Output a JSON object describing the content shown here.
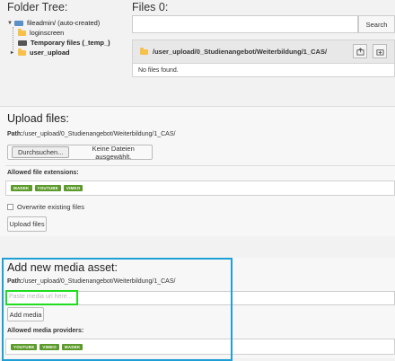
{
  "folder_tree": {
    "title": "Folder Tree:",
    "root": "fileadmin/ (auto-created)",
    "items": [
      "loginscreen",
      "Temporary files (_temp_)",
      "user_upload"
    ]
  },
  "files": {
    "title": "Files 0:",
    "search_placeholder": "",
    "search_button": "Search",
    "path": "/user_upload/0_Studienangebot/Weiterbildung/1_CAS/",
    "empty_message": "No files found."
  },
  "upload": {
    "title": "Upload files:",
    "path_label": "Path:",
    "path": "/user_upload/0_Studienangebot/Weiterbildung/1_CAS/",
    "browse_button": "Durchsuchen...",
    "no_files_text": "Keine Dateien ausgewählt.",
    "extensions_label": "Allowed file extensions:",
    "extensions": [
      "MADEK",
      "YOUTUBE",
      "VIMEO"
    ],
    "overwrite_label": "Overwrite existing files",
    "overwrite_checked": false,
    "submit_button": "Upload files"
  },
  "media": {
    "title": "Add new media asset:",
    "path_label": "Path:",
    "path": "/user_upload/0_Studienangebot/Weiterbildung/1_CAS/",
    "url_placeholder": "Paste media url here...",
    "add_button": "Add media",
    "providers_label": "Allowed media providers:",
    "providers": [
      "YOUTUBE",
      "VIMEO",
      "MADEK"
    ]
  },
  "colors": {
    "badge_green": "#5c9b2a",
    "highlight_blue": "#1e9fd6",
    "highlight_green": "#20dd20",
    "folder_yellow": "#f6c04a"
  },
  "icons": {
    "upload_icon": "folder-upload-icon",
    "new_folder_icon": "new-folder-icon"
  }
}
